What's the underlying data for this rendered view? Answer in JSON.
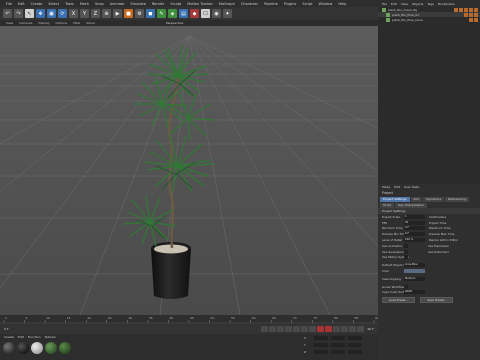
{
  "menubar": {
    "items": [
      "File",
      "Edit",
      "Create",
      "Select",
      "Tools",
      "Mesh",
      "Snap",
      "Animate",
      "Simulate",
      "Render",
      "Sculpt",
      "Motion Tracker",
      "MoGraph",
      "Character",
      "Pipeline",
      "Plugins",
      "Script",
      "Window",
      "Help"
    ]
  },
  "subbar": {
    "items": [
      "View",
      "Cameras",
      "Display",
      "Options",
      "Filter",
      "Panel"
    ],
    "title": "Perspective"
  },
  "object_manager": {
    "menu": [
      "File",
      "Edit",
      "View",
      "Objects",
      "Tags",
      "Bookmarks"
    ],
    "objects": [
      {
        "name": "plant_fbx_mesh.obj"
      },
      {
        "name": "plant_fbx_Pine_01"
      },
      {
        "name": "plant_fbx_Pine_Cone"
      }
    ]
  },
  "attributes": {
    "menu": [
      "Mode",
      "Edit",
      "User Data"
    ],
    "header": "Project",
    "tabs": [
      "Project Settings",
      "Info",
      "Dynamics",
      "Referencing",
      "To Do",
      "Key Interpolation"
    ],
    "section": "Project Settings",
    "rows": [
      {
        "label": "Project Scale",
        "value": "1",
        "label2": "Centimeters"
      },
      {
        "label": "FPS",
        "value": "30",
        "label2": "Project Time"
      },
      {
        "label": "Minimum Time",
        "value": "0 F",
        "label2": "Maximum Time"
      },
      {
        "label": "Preview Min Time",
        "value": "0 F",
        "label2": "Preview Max Time"
      },
      {
        "label": "Level of Detail",
        "value": "100 %",
        "label2": "Render LOD in Editor"
      },
      {
        "label": "Use Animation",
        "value": "",
        "label2": "Use Expression"
      },
      {
        "label": "Use Generators",
        "value": "",
        "label2": "Use Deformers"
      },
      {
        "label": "Use Motion System",
        "value": "",
        "label2": ""
      },
      {
        "label": "Default Object Color",
        "value": "Gray-Blue",
        "label2": ""
      },
      {
        "label": "Color",
        "value": "",
        "label2": ""
      },
      {
        "label": "View Clipping",
        "value": "Medium",
        "label2": ""
      },
      {
        "label": "Linear Workflow",
        "value": "",
        "label2": ""
      },
      {
        "label": "Input Color Profile",
        "value": "sRGB",
        "label2": ""
      }
    ],
    "buttons": [
      "Load Preset...",
      "Save Preset..."
    ]
  },
  "timeline": {
    "ticks": [
      "0",
      "5",
      "10",
      "15",
      "20",
      "25",
      "30",
      "35",
      "40",
      "45",
      "50",
      "55",
      "60",
      "65",
      "70",
      "75",
      "80",
      "85",
      "90"
    ]
  },
  "transport": {
    "start": "0 F",
    "end": "90 F"
  },
  "materials": {
    "menu": [
      "Create",
      "Edit",
      "Function",
      "Texture"
    ]
  },
  "coordinates": {
    "labels": [
      "X",
      "Y",
      "Z"
    ]
  },
  "colors": {
    "plant": "#2f7a34",
    "pot": "#1a1a1a",
    "soil": "#c9c2b3",
    "grid": "#6a6a6a"
  }
}
